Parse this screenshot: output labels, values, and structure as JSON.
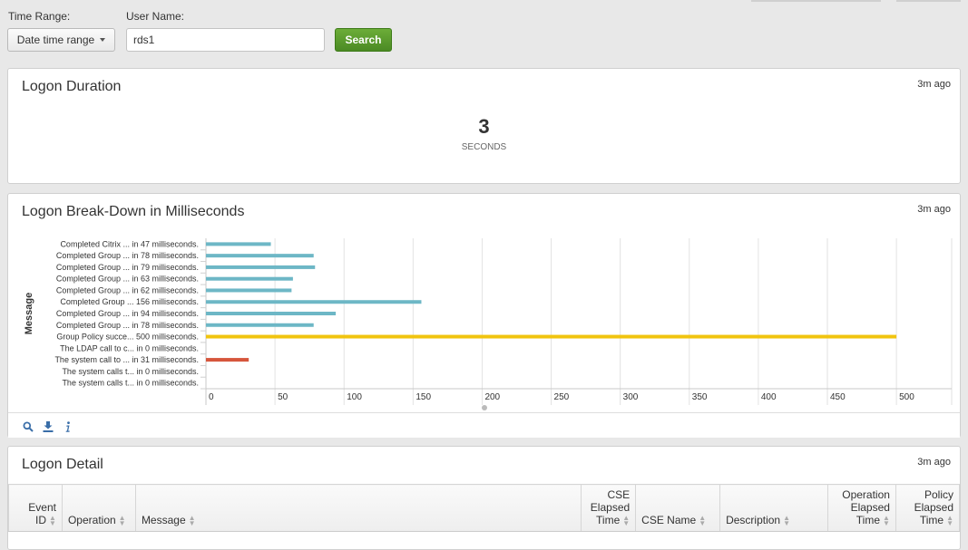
{
  "form": {
    "time_range_label": "Time Range:",
    "time_range_value": "Date time range",
    "user_name_label": "User Name:",
    "user_name_value": "rds1",
    "search_label": "Search"
  },
  "duration_panel": {
    "title": "Logon Duration",
    "time_ago": "3m ago",
    "value": "3",
    "unit": "SECONDS"
  },
  "breakdown_panel": {
    "title": "Logon Break-Down in Milliseconds",
    "time_ago": "3m ago",
    "icons": [
      "search-icon",
      "download-icon",
      "info-icon"
    ]
  },
  "detail_panel": {
    "title": "Logon Detail",
    "time_ago": "3m ago",
    "columns": [
      "Event ID",
      "Operation",
      "Message",
      "CSE Elapsed Time",
      "CSE Name",
      "Description",
      "Operation Elapsed Time",
      "Policy Elapsed Time"
    ]
  },
  "chart_data": {
    "type": "bar",
    "orientation": "horizontal",
    "title": "Logon Break-Down in Milliseconds",
    "ylabel": "Message",
    "xlabel": "",
    "xlim": [
      0,
      540
    ],
    "x_ticks": [
      0,
      50,
      100,
      150,
      200,
      250,
      300,
      350,
      400,
      450,
      500
    ],
    "grid": true,
    "categories": [
      "Completed Citrix ... in 47 milliseconds.",
      "Completed Group ... in 78 milliseconds.",
      "Completed Group ... in 79 milliseconds.",
      "Completed Group ... in 63 milliseconds.",
      "Completed Group ... in 62 milliseconds.",
      "Completed Group ... 156 milliseconds.",
      "Completed Group ... in 94 milliseconds.",
      "Completed Group ... in 78 milliseconds.",
      "Group Policy succe... 500 milliseconds.",
      "The LDAP call to c... in 0 milliseconds.",
      "The system call to ... in 31 milliseconds.",
      "The system calls t... in 0 milliseconds.",
      "The system calls t... in 0 milliseconds."
    ],
    "values": [
      47,
      78,
      79,
      63,
      62,
      156,
      94,
      78,
      500,
      0,
      31,
      0,
      0
    ],
    "colors": [
      "#6db7c6",
      "#6db7c6",
      "#6db7c6",
      "#6db7c6",
      "#6db7c6",
      "#6db7c6",
      "#6db7c6",
      "#6db7c6",
      "#f1c40f",
      "#6db7c6",
      "#d6563c",
      "#6db7c6",
      "#6db7c6"
    ]
  }
}
